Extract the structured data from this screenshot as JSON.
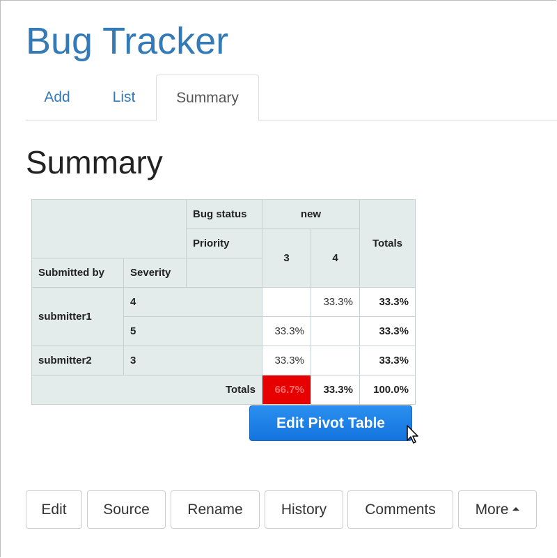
{
  "app": {
    "title": "Bug Tracker"
  },
  "tabs": [
    {
      "label": "Add",
      "active": false
    },
    {
      "label": "List",
      "active": false
    },
    {
      "label": "Summary",
      "active": true
    }
  ],
  "page": {
    "heading": "Summary"
  },
  "pivot": {
    "col_headers": {
      "bug_status_label": "Bug status",
      "bug_status_value": "new",
      "priority_label": "Priority",
      "priorities": [
        "3",
        "4"
      ],
      "totals_label": "Totals"
    },
    "row_headers": {
      "submitted_by": "Submitted by",
      "severity": "Severity"
    },
    "rows": [
      {
        "submitter": "submitter1",
        "severity": "4",
        "p3": "",
        "p4": "33.3%",
        "total": "33.3%"
      },
      {
        "submitter": "",
        "severity": "5",
        "p3": "33.3%",
        "p4": "",
        "total": "33.3%"
      },
      {
        "submitter": "submitter2",
        "severity": "3",
        "p3": "33.3%",
        "p4": "",
        "total": "33.3%"
      }
    ],
    "totals_row": {
      "label": "Totals",
      "p3": "66.7%",
      "p4": "33.3%",
      "total": "100.0%"
    },
    "highlight_color": "#e60000"
  },
  "edit_pivot_button": {
    "label": "Edit Pivot Table"
  },
  "actions": [
    {
      "label": "Edit"
    },
    {
      "label": "Source"
    },
    {
      "label": "Rename"
    },
    {
      "label": "History"
    },
    {
      "label": "Comments"
    },
    {
      "label": "More",
      "icon": "caret-up-icon"
    }
  ],
  "colors": {
    "link": "#337ab7",
    "button_primary": "#1474de",
    "header_bg": "#e3ebeb"
  }
}
